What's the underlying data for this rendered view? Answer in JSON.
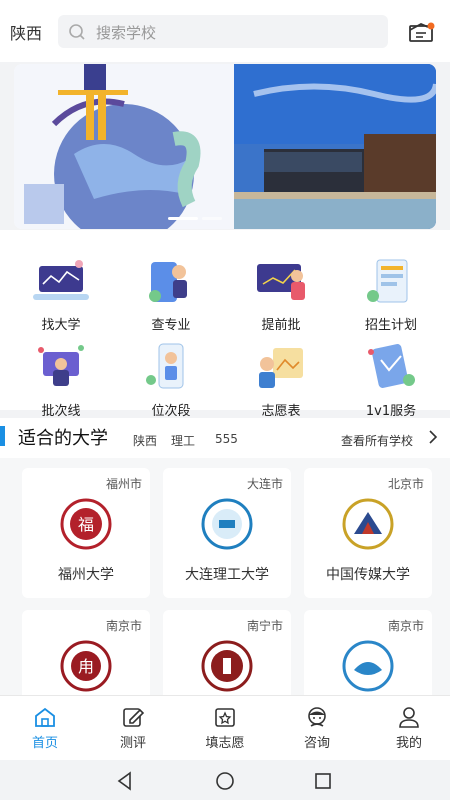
{
  "header": {
    "region": "陕西",
    "search_placeholder": "搜索学校"
  },
  "features": [
    {
      "label": "找大学",
      "icon": "find-university-icon"
    },
    {
      "label": "查专业",
      "icon": "search-major-icon"
    },
    {
      "label": "提前批",
      "icon": "early-batch-icon"
    },
    {
      "label": "招生计划",
      "icon": "enrollment-plan-icon"
    },
    {
      "label": "批次线",
      "icon": "batch-line-icon"
    },
    {
      "label": "位次段",
      "icon": "rank-segment-icon"
    },
    {
      "label": "志愿表",
      "icon": "application-form-icon"
    },
    {
      "label": "1v1服务",
      "icon": "one-on-one-service-icon"
    }
  ],
  "section": {
    "title": "适合的大学",
    "tags": [
      "陕西",
      "理工",
      "555"
    ],
    "more_label": "查看所有学校"
  },
  "universities": [
    {
      "city": "福州市",
      "name": "福州大学",
      "color": "#b3212b"
    },
    {
      "city": "大连市",
      "name": "大连理工大学",
      "color": "#1f7fbf"
    },
    {
      "city": "北京市",
      "name": "中国传媒大学",
      "color": "#c9a227"
    },
    {
      "city": "南京市",
      "name": "",
      "color": "#9a1b22"
    },
    {
      "city": "南宁市",
      "name": "",
      "color": "#8c1d1d"
    },
    {
      "city": "南京市",
      "name": "",
      "color": "#2a86c8"
    }
  ],
  "nav": {
    "active_color": "#1a8fe3",
    "items": [
      {
        "label": "首页",
        "icon": "home-icon"
      },
      {
        "label": "测评",
        "icon": "edit-icon"
      },
      {
        "label": "填志愿",
        "icon": "star-form-icon"
      },
      {
        "label": "咨询",
        "icon": "consultant-icon"
      },
      {
        "label": "我的",
        "icon": "user-icon"
      }
    ]
  }
}
